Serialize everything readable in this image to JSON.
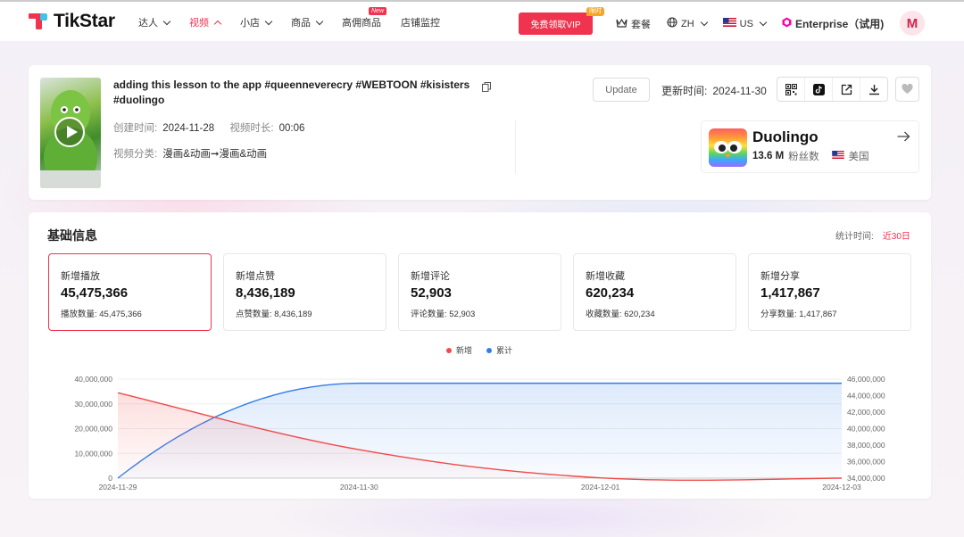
{
  "brand": {
    "name": "TikStar",
    "accent": "#f0344f"
  },
  "nav": {
    "items": [
      {
        "label": "达人",
        "dropdown": true,
        "active": false
      },
      {
        "label": "视频",
        "dropdown": true,
        "active": true
      },
      {
        "label": "小店",
        "dropdown": true,
        "active": false
      },
      {
        "label": "商品",
        "dropdown": true,
        "active": false
      },
      {
        "label": "高佣商品",
        "dropdown": false,
        "active": false,
        "badge": "New"
      },
      {
        "label": "店铺监控",
        "dropdown": false,
        "active": false
      }
    ],
    "vip_button": "免费领取VIP",
    "vip_badge": "限时",
    "plans": "套餐",
    "language": "ZH",
    "region": "US",
    "enterprise": "Enterprise（试用)",
    "avatar_letter": "M"
  },
  "video": {
    "title": "adding this lesson to the app #queenneverecry #WEBTOON #kisisters #duolingo",
    "created_label": "创建时间:",
    "created_value": "2024-11-28",
    "duration_label": "视频时长:",
    "duration_value": "00:06",
    "category_label": "视频分类:",
    "category_value": "漫画&动画➞漫画&动画",
    "update_button": "Update",
    "updated_label": "更新时间:",
    "updated_value": "2024-11-30",
    "actions": [
      "qr-code-icon",
      "tiktok-icon",
      "external-link-icon",
      "download-icon"
    ],
    "favorite_icon": "heart-icon"
  },
  "account": {
    "name": "Duolingo",
    "followers": "13.6 M",
    "followers_label": "粉丝数",
    "country": "美国"
  },
  "stats": {
    "title": "基础信息",
    "range_label": "统计时间:",
    "range_value": "近30日",
    "metrics": [
      {
        "label": "新增播放",
        "value": "45,475,366",
        "sub": "播放数量: 45,475,366",
        "active": true
      },
      {
        "label": "新增点赞",
        "value": "8,436,189",
        "sub": "点赞数量: 8,436,189",
        "active": false
      },
      {
        "label": "新增评论",
        "value": "52,903",
        "sub": "评论数量: 52,903",
        "active": false
      },
      {
        "label": "新增收藏",
        "value": "620,234",
        "sub": "收藏数量: 620,234",
        "active": false
      },
      {
        "label": "新增分享",
        "value": "1,417,867",
        "sub": "分享数量: 1,417,867",
        "active": false
      }
    ]
  },
  "chart_data": {
    "type": "area",
    "x": [
      "2024-11-29",
      "2024-11-30",
      "2024-12-01",
      "2024-12-03"
    ],
    "x_numeric_days": [
      0,
      1,
      2,
      3
    ],
    "series": [
      {
        "name": "新增",
        "axis": "left",
        "color": "#f04a4a",
        "x": [
          0,
          1,
          2,
          3
        ],
        "values": [
          34500000,
          11500000,
          100000,
          0
        ]
      },
      {
        "name": "累计",
        "axis": "right",
        "color": "#2f7ee8",
        "x": [
          0,
          1,
          2,
          3
        ],
        "values": [
          34000000,
          45500000,
          45500000,
          45500000
        ]
      }
    ],
    "left_ticks": [
      "40,000,000",
      "30,000,000",
      "20,000,000",
      "10,000,000",
      "0"
    ],
    "right_ticks": [
      "46,000,000",
      "44,000,000",
      "42,000,000",
      "40,000,000",
      "38,000,000",
      "36,000,000",
      "34,000,000"
    ],
    "ylim_left": [
      0,
      40000000
    ],
    "ylim_right": [
      34000000,
      46000000
    ],
    "grid": true,
    "legend": "top-center"
  }
}
